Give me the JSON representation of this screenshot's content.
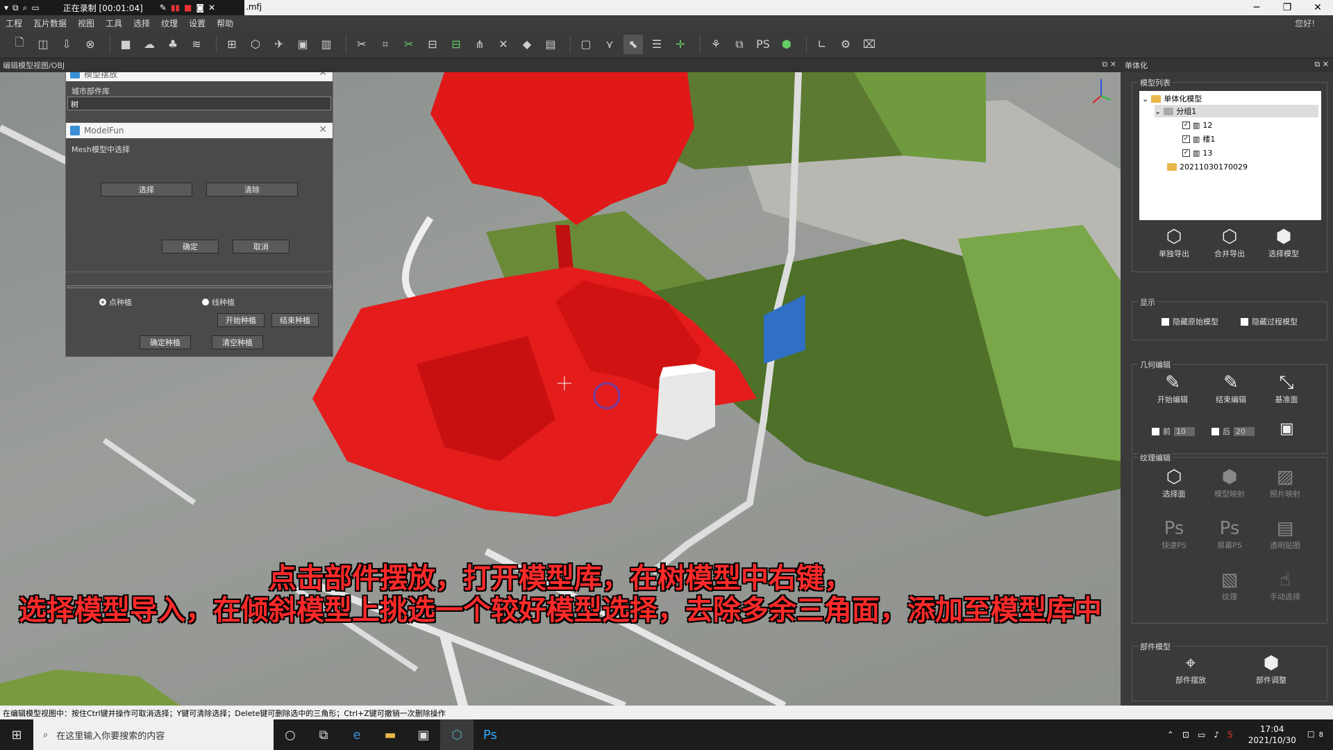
{
  "titlebar": {
    "recording": "正在录制 [00:01:04]",
    "file": ".mfj",
    "minimize": "─",
    "maximize": "❐",
    "close": "✕"
  },
  "menu": {
    "items": [
      "工程",
      "瓦片数据",
      "视图",
      "工具",
      "选择",
      "纹理",
      "设置",
      "帮助"
    ],
    "greeting": "您好!"
  },
  "viewport": {
    "header": "编辑模型视图/OBJ",
    "subtitle_line1": "点击部件摆放，打开模型库，在树模型中右键，",
    "subtitle_line2": "选择模型导入，在倾斜模型上挑选一个较好模型选择，去除多余三角面，添加至模型库中"
  },
  "dialog_layout": {
    "title": "模型摆放",
    "library_label": "城市部件库",
    "search_value": "树",
    "radio_point": "点种植",
    "radio_line": "线种植",
    "start_plant": "开始种植",
    "end_plant": "结束种植",
    "confirm_plant": "确定种植",
    "clear_plant": "清空种植"
  },
  "dialog_modelfun": {
    "title": "ModelFun",
    "desc": "Mesh模型中选择",
    "select": "选择",
    "clear": "清除",
    "ok": "确定",
    "cancel": "取消"
  },
  "right_panel": {
    "title": "单体化",
    "model_list_label": "模型列表",
    "tree": {
      "root": "单体化模型",
      "group": "分组1",
      "items": [
        "12",
        "楼1",
        "13"
      ],
      "other": "20211030170029"
    },
    "export_single": "单独导出",
    "export_merge": "合并导出",
    "select_model": "选择模型",
    "display_label": "显示",
    "hide_original": "隐藏原始模型",
    "hide_process": "隐藏过程模型",
    "geo_label": "几何编辑",
    "start_edit": "开始编辑",
    "end_edit": "结束编辑",
    "base_plane": "基准面",
    "front_label": "前",
    "front_value": "10",
    "back_label": "后",
    "back_value": "20",
    "tex_label": "纹理编辑",
    "select_face": "选择面",
    "model_map": "模型映射",
    "photo_map": "照片映射",
    "quick_ps": "快速PS",
    "screen_ps": "屏幕PS",
    "transparent": "透明贴图",
    "texture_partial": "纹理",
    "manual_select": "手动选择",
    "parts_label": "部件模型",
    "parts_place": "部件摆放",
    "parts_adjust": "部件调整"
  },
  "statusbar": {
    "text": "在编辑模型视图中：按住Ctrl键并操作可取消选择；Y键可清除选择；Delete键可删除选中的三角形；Ctrl+Z键可撤销一次删除操作"
  },
  "taskbar": {
    "search_placeholder": "在这里输入你要搜索的内容",
    "time": "17:04",
    "date": "2021/10/30",
    "notif_count": "8"
  }
}
